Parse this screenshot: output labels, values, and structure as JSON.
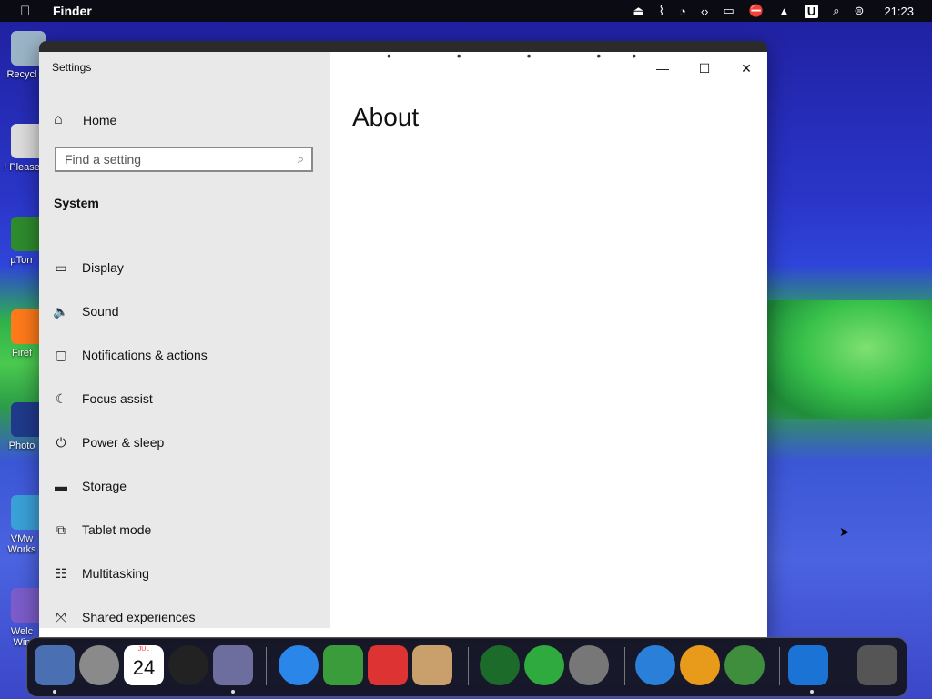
{
  "menubar": {
    "apple_icon": "apple-icon",
    "app_name": "Finder",
    "clock": "21:23",
    "status_icons": [
      "eject-icon",
      "brush-icon",
      "pie-icon",
      "code-icon",
      "display-icon",
      "nosignal-icon",
      "eject2-icon",
      "u-icon",
      "search-icon",
      "control-center-icon"
    ]
  },
  "desktop_icons": [
    {
      "label": "Recycl",
      "color": "#9bb4c7"
    },
    {
      "label": "! Please",
      "color": "#dcdcdc"
    },
    {
      "label": "µTorr",
      "color": "#2e8b2e"
    },
    {
      "label": "Firef",
      "color": "#ff7a1a"
    },
    {
      "label": "Photo",
      "color": "#1f3a8a"
    },
    {
      "label": "VMw\nWorks",
      "color": "#3aa0d6"
    },
    {
      "label": "Welc\nWin",
      "color": "#7b5cc8"
    }
  ],
  "window": {
    "title": "Settings",
    "minimize_glyph": "—",
    "maximize_glyph": "☐",
    "close_glyph": "✕"
  },
  "sidebar": {
    "home_label": "Home",
    "search_placeholder": "Find a setting",
    "section": "System",
    "items": [
      {
        "label": "Display",
        "icon": "▭"
      },
      {
        "label": "Sound",
        "icon": "🔈"
      },
      {
        "label": "Notifications & actions",
        "icon": "▢"
      },
      {
        "label": "Focus assist",
        "icon": "☾"
      },
      {
        "label": "Power & sleep",
        "icon": "⏻"
      },
      {
        "label": "Storage",
        "icon": "▬"
      },
      {
        "label": "Tablet mode",
        "icon": "⧉"
      },
      {
        "label": "Multitasking",
        "icon": "☷"
      },
      {
        "label": "Shared experiences",
        "icon": "⤧"
      }
    ]
  },
  "content": {
    "title": "About"
  },
  "dock": {
    "items": [
      {
        "name": "finder",
        "color": "#4a6fb3"
      },
      {
        "name": "launchpad",
        "color": "#8a8a8a"
      },
      {
        "name": "calendar",
        "month": "JUL",
        "day": "24"
      },
      {
        "name": "clock",
        "color": "#222"
      },
      {
        "name": "siri",
        "color": "#6e6e9e"
      },
      {
        "name": "safari",
        "color": "#2a86e8"
      },
      {
        "name": "utorrent",
        "color": "#3a9c3a"
      },
      {
        "name": "parallels",
        "color": "#d33"
      },
      {
        "name": "preview",
        "color": "#c9a06b"
      },
      {
        "name": "collabsysos",
        "color": "#1d6b2a"
      },
      {
        "name": "link",
        "color": "#2eaa3e"
      },
      {
        "name": "utilities",
        "color": "#777"
      },
      {
        "name": "www",
        "color": "#2a7fd8"
      },
      {
        "name": "download",
        "color": "#e89a1a"
      },
      {
        "name": "group",
        "color": "#3e8e3e"
      },
      {
        "name": "settings",
        "color": "#1c73d6"
      },
      {
        "name": "trash",
        "color": "#555"
      }
    ]
  }
}
